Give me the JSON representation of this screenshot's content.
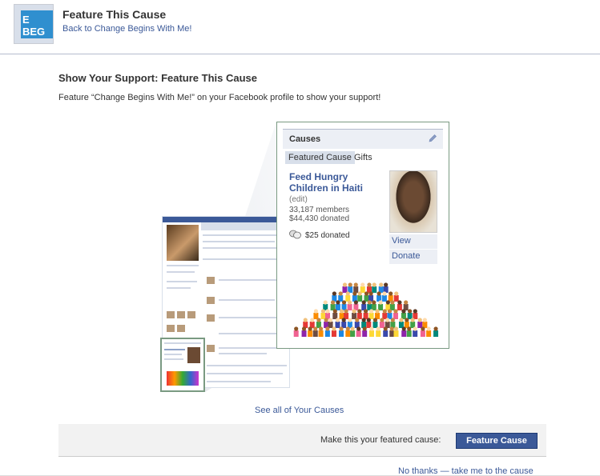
{
  "header": {
    "logo_text": "E BEG V",
    "title": "Feature This Cause",
    "back_link": "Back to Change Begins With Me!"
  },
  "section": {
    "title": "Show Your Support: Feature This Cause",
    "description": "Feature “Change Begins With Me!” on your Facebook profile to show your support!"
  },
  "causes_box": {
    "title": "Causes",
    "tabs": [
      "Featured Cause",
      "Gifts"
    ],
    "cause_name": "Feed Hungry Children in Haiti",
    "edit_label": "(edit)",
    "members": "33,187 members",
    "donated_total": "$44,430 donated",
    "user_donated": "$25 donated",
    "actions": [
      "View",
      "Donate"
    ]
  },
  "see_all_link": "See all of Your Causes",
  "action_bar": {
    "prompt": "Make this your featured cause:",
    "button": "Feature Cause"
  },
  "no_thanks_link": "No thanks — take me to the cause",
  "colors": {
    "facebook_blue": "#3b5998",
    "panel_border": "#7a9a82",
    "bar_bg": "#f2f2f2"
  }
}
